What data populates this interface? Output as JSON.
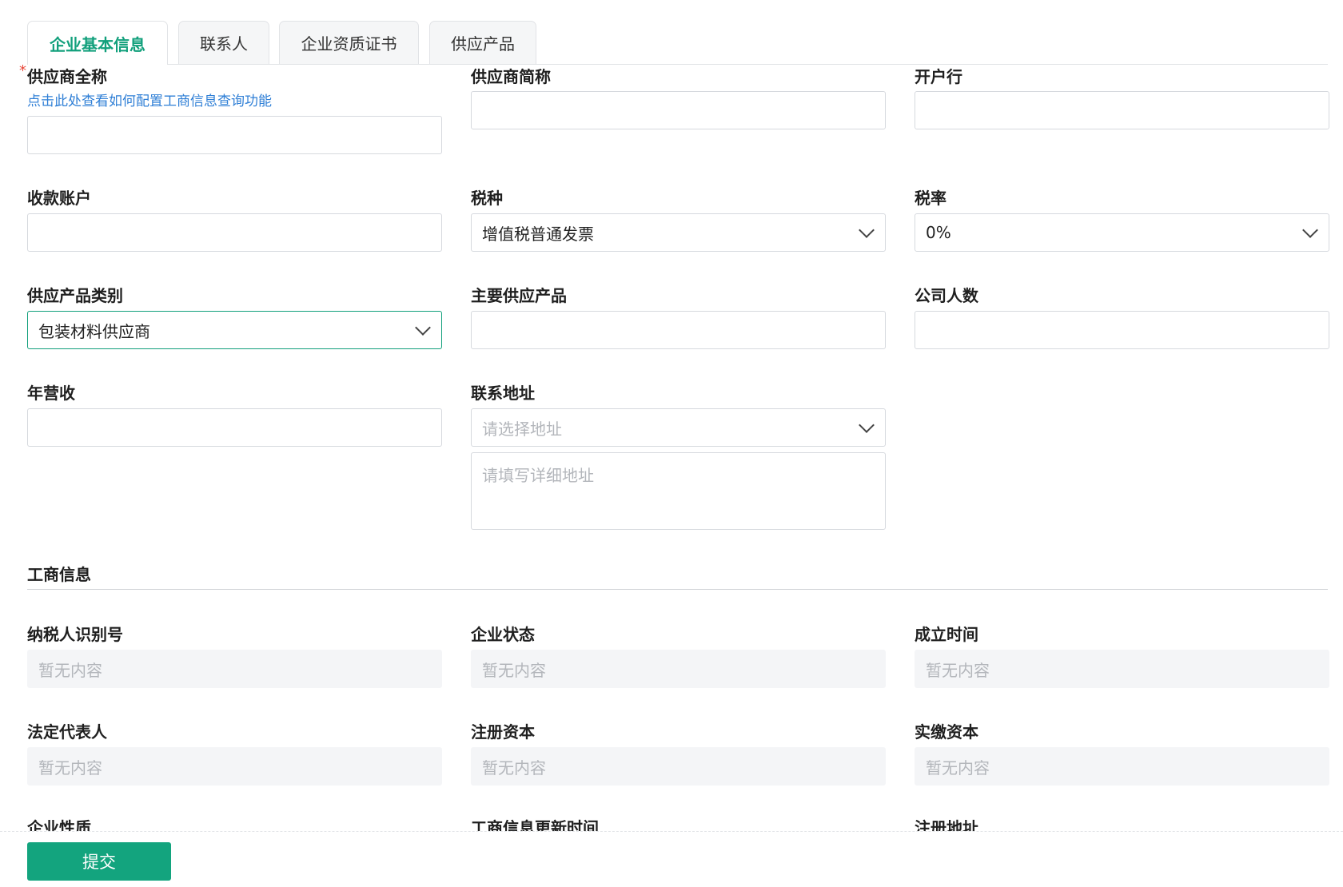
{
  "tabs": [
    {
      "label": "企业基本信息"
    },
    {
      "label": "联系人"
    },
    {
      "label": "企业资质证书"
    },
    {
      "label": "供应产品"
    }
  ],
  "basic": {
    "full_name": {
      "label": "供应商全称",
      "required_mark": "*",
      "hint": "点击此处查看如何配置工商信息查询功能",
      "value": ""
    },
    "short_name": {
      "label": "供应商简称",
      "value": ""
    },
    "bank": {
      "label": "开户行",
      "value": ""
    },
    "account": {
      "label": "收款账户",
      "value": ""
    },
    "tax_type": {
      "label": "税种",
      "value": "增值税普通发票"
    },
    "tax_rate": {
      "label": "税率",
      "value": "0%"
    },
    "product_category": {
      "label": "供应产品类别",
      "value": "包装材料供应商"
    },
    "main_products": {
      "label": "主要供应产品",
      "value": ""
    },
    "employees": {
      "label": "公司人数",
      "value": ""
    },
    "revenue": {
      "label": "年营收",
      "value": ""
    },
    "address": {
      "label": "联系地址",
      "select_placeholder": "请选择地址",
      "detail_placeholder": "请填写详细地址"
    }
  },
  "business": {
    "title": "工商信息",
    "empty_text": "暂无内容",
    "fields": [
      {
        "label": "纳税人识别号"
      },
      {
        "label": "企业状态"
      },
      {
        "label": "成立时间"
      },
      {
        "label": "法定代表人"
      },
      {
        "label": "注册资本"
      },
      {
        "label": "实缴资本"
      }
    ],
    "clipped_labels": [
      "企业性质",
      "工商信息更新时间",
      "注册地址"
    ]
  },
  "footer": {
    "submit_label": "提交"
  },
  "colors": {
    "accent": "#13a47e",
    "link": "#2f7fd6",
    "required": "#e8483a"
  }
}
